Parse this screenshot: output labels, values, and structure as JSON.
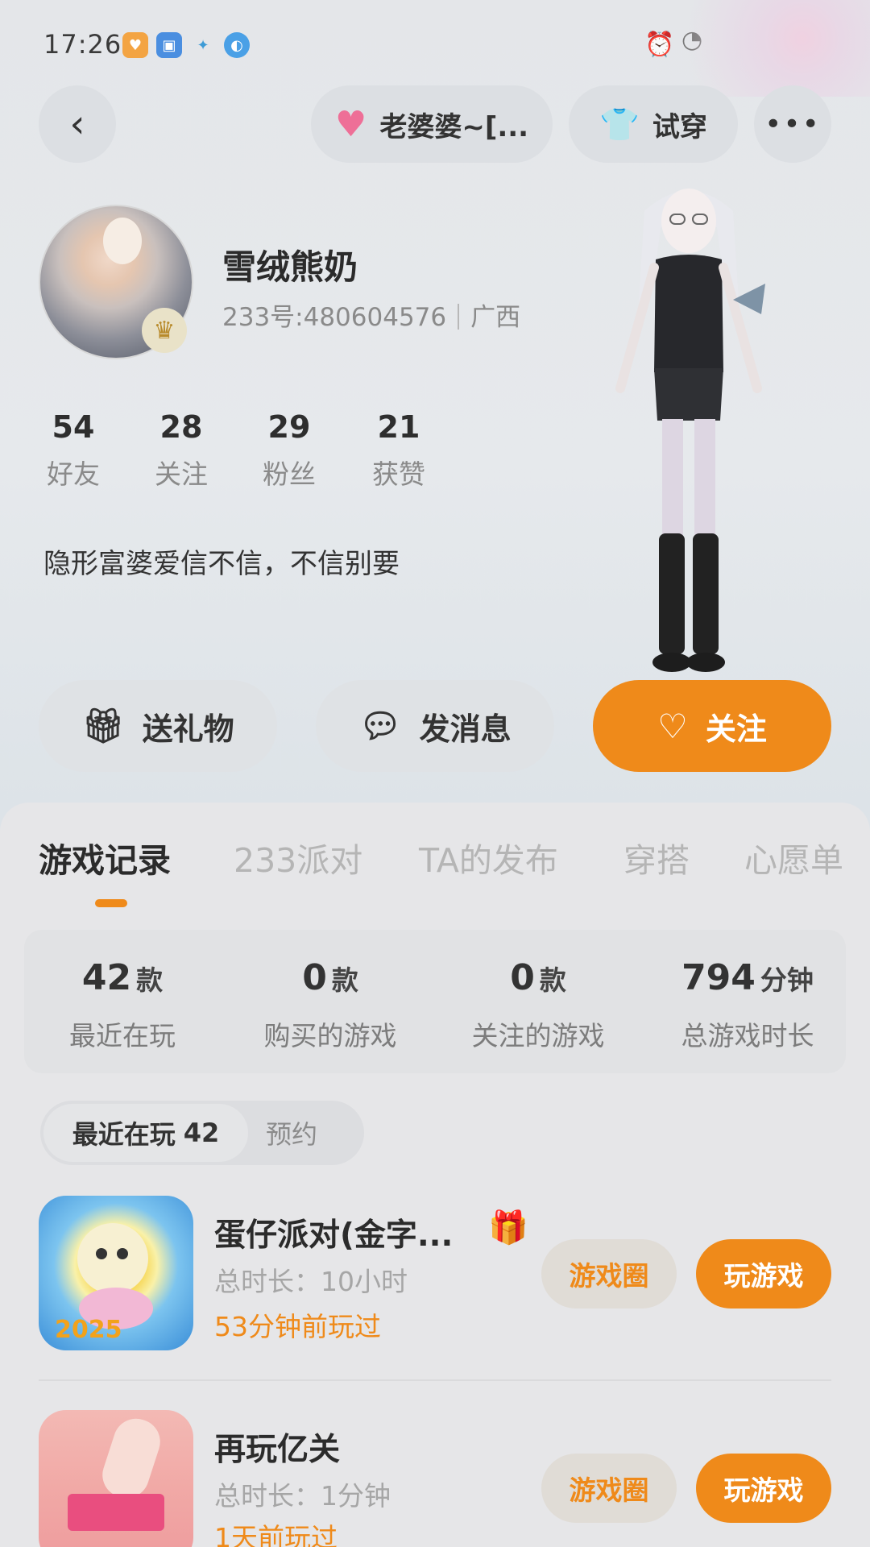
{
  "status_bar": {
    "time": "17:26"
  },
  "top_bar": {
    "back_glyph": "‹",
    "couple_label": "老婆婆~[...",
    "try_on_label": "试穿",
    "more_glyph": "•••"
  },
  "profile": {
    "nickname": "雪绒熊奶",
    "id_text": "233号:480604576",
    "region": "广西",
    "stats": [
      {
        "value": "54",
        "label": "好友"
      },
      {
        "value": "28",
        "label": "关注"
      },
      {
        "value": "29",
        "label": "粉丝"
      },
      {
        "value": "21",
        "label": "获赞"
      }
    ],
    "bio": "隐形富婆爱信不信，不信别要"
  },
  "actions": {
    "gift_label": "送礼物",
    "message_label": "发消息",
    "follow_label": "关注"
  },
  "tabs": [
    {
      "label": "游戏记录",
      "active": true
    },
    {
      "label": "233派对",
      "active": false
    },
    {
      "label": "TA的发布",
      "active": false
    },
    {
      "label": "穿搭",
      "active": false
    },
    {
      "label": "心愿单",
      "active": false
    }
  ],
  "game_stats": [
    {
      "value": "42",
      "unit": "款",
      "label": "最近在玩"
    },
    {
      "value": "0",
      "unit": "款",
      "label": "购买的游戏"
    },
    {
      "value": "0",
      "unit": "款",
      "label": "关注的游戏"
    },
    {
      "value": "794",
      "unit": "分钟",
      "label": "总游戏时长"
    }
  ],
  "subtabs": {
    "recent_label": "最近在玩",
    "recent_count": "42",
    "reserve_label": "预约"
  },
  "games": [
    {
      "title": "蛋仔派对(金字...",
      "duration": "总时长：10小时",
      "last_played": "53分钟前玩过",
      "circle_label": "游戏圈",
      "play_label": "玩游戏"
    },
    {
      "title": "再玩亿关",
      "duration": "总时长：1分钟",
      "last_played": "1天前玩过",
      "circle_label": "游戏圈",
      "play_label": "玩游戏"
    }
  ],
  "colors": {
    "accent": "#ef8a1a",
    "heart": "#ee6f97"
  },
  "icons": [
    "back-icon",
    "heart-icon",
    "shirt-icon",
    "more-icon",
    "crown-icon",
    "gift-icon",
    "message-icon",
    "heart-plus-icon",
    "alarm-icon",
    "wifi-icon"
  ]
}
